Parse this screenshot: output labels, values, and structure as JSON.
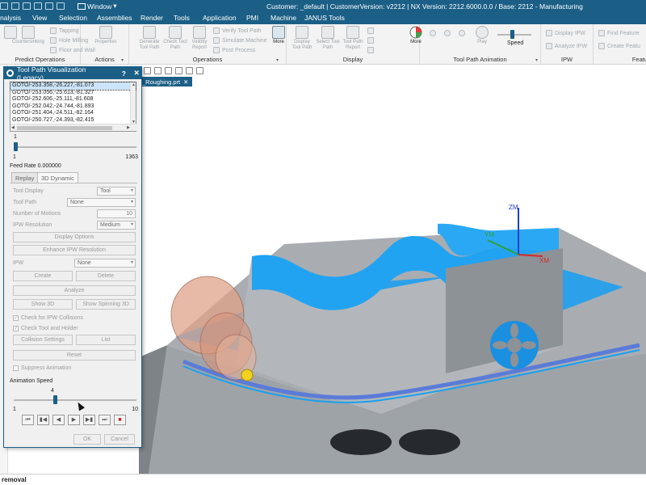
{
  "titlebar": {
    "window_menu": "Window",
    "title": "Customer: _default | CustomerVersion: v2212 | NX Version: 2212.6000.0.0 / Base: 2212 - Manufacturing"
  },
  "menu_tabs": [
    "nalysis",
    "View",
    "Selection",
    "Assemblies",
    "Render",
    "Tools",
    "Application",
    "PMI",
    "Machine",
    "JANUS Tools"
  ],
  "ribbon": {
    "predict_ops": {
      "label": "Predict Operations",
      "countersinking": "Countersinking",
      "tapping": "Tapping",
      "hole_milling": "Hole Milling",
      "floor_wall": "Floor and Wall"
    },
    "actions": {
      "label": "Actions",
      "properties": "Properties"
    },
    "operations": {
      "label": "Operations",
      "generate": "Generate Tool Path",
      "check": "Check Tool Path",
      "validity": "Validity Report",
      "verify": "Verify Tool Path",
      "simulate": "Simulate Machine",
      "postprocess": "Post Process",
      "more": "More"
    },
    "display": {
      "label": "Display",
      "display_tp": "Display Tool Path",
      "select_tp": "Select Tool Path",
      "tp_report": "Tool Path Report",
      "more": "More"
    },
    "animation": {
      "label": "Tool Path Animation",
      "play": "Play",
      "speed": "Speed"
    },
    "ipw": {
      "label": "IPW",
      "display_ipw": "Display IPW",
      "analyze_ipw": "Analyze IPW"
    },
    "feature": {
      "label": "Featu",
      "find": "Find Feature",
      "create": "Create Featu"
    }
  },
  "document_tab": "_Roughing.prt",
  "status_text": "removal",
  "dialog": {
    "title": "Tool Path Visualization (Legacy)",
    "goto_rows": [
      "GOTO/-253.358,-26.227,-81.073",
      "GOTO/-253.056,-25.613,-81.327",
      "GOTO/-252.606,-25.111,-81.608",
      "GOTO/-252.042,-24.744,-81.893",
      "GOTO/-251.404,-24.511,-82.164",
      "GOTO/-250.727,-24.393,-82.415"
    ],
    "motion_slider": {
      "value": "1",
      "min": "1",
      "max": "1363",
      "fraction": 0.0
    },
    "feed_rate": "Feed Rate 0.000000",
    "tabs": {
      "replay": "Replay",
      "dynamic": "3D Dynamic"
    },
    "tool_display": {
      "label": "Tool Display",
      "value": "Tool"
    },
    "tool_path": {
      "label": "Tool Path",
      "value": "None"
    },
    "num_motions": {
      "label": "Number of Motions",
      "value": "10"
    },
    "ipw_resolution": {
      "label": "IPW Resolution",
      "value": "Medium"
    },
    "display_options": "Display Options",
    "enhance_ipw": "Enhance IPW Resolution",
    "ipw": {
      "label": "IPW",
      "value": "None"
    },
    "create": "Create",
    "delete": "Delete",
    "analyze": "Analyze",
    "show_3d": "Show 3D",
    "show_spinning": "Show Spinning 3D",
    "check_collisions": "Check for IPW Collisions",
    "check_tool_holder": "Check Tool and Holder",
    "collision_settings": "Collision Settings",
    "list": "List",
    "reset": "Reset",
    "suppress_animation": "Suppress Animation",
    "anim_speed": {
      "label": "Animation Speed",
      "value": "4",
      "min": "1",
      "max": "10",
      "fraction": 0.333
    },
    "ok": "OK",
    "cancel": "Cancel"
  },
  "axes": {
    "z": "ZM",
    "y": "YM",
    "x": "XM"
  },
  "colors": {
    "brand": "#1b5f86",
    "part_blue": "#1aa0f0",
    "part_grey": "#a7abb0",
    "tool_copper": "#e0a38a"
  }
}
